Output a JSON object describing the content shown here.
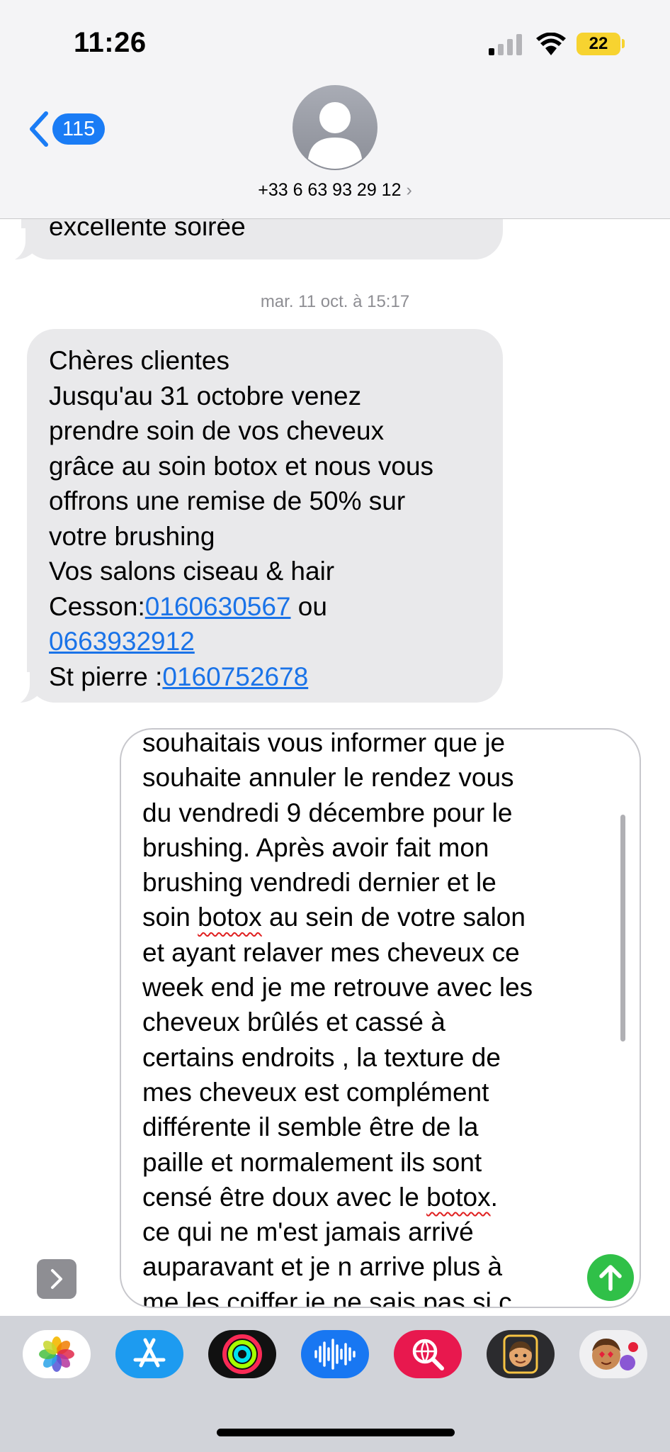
{
  "status_bar": {
    "time": "11:26",
    "battery": "22"
  },
  "header": {
    "back_count": "115",
    "contact": "+33 6 63 93 29 12",
    "chevron": "›"
  },
  "thread": {
    "previous_tail_line": "excellente soirée",
    "timestamp": "mar. 11 oct. à 15:17",
    "message": {
      "lines": [
        "Chères clientes",
        "Jusqu'au 31 octobre venez",
        "prendre soin de vos cheveux",
        "grâce au soin botox et nous vous",
        "offrons une remise de 50% sur",
        "votre brushing",
        "Vos salons ciseau & hair"
      ],
      "cesson_label": "Cesson:",
      "cesson_phone1": "0160630567",
      "or_text": " ou",
      "cesson_phone2": "0663932912",
      "stpierre_label": "St pierre :",
      "stpierre_phone": "0160752678"
    }
  },
  "compose": {
    "lines": [
      "souhaitais vous informer que je",
      "souhaite annuler le rendez vous",
      "du vendredi 9 décembre pour le",
      "brushing. Après avoir fait mon",
      "brushing vendredi dernier et le",
      "soin |botox| au sein de votre salon",
      "et ayant relaver mes cheveux ce",
      "week end je me retrouve avec les",
      "cheveux brûlés et cassé à",
      "certains endroits  , la texture de",
      "mes cheveux est complément",
      "différente il semble être de la",
      "paille et normalement ils sont",
      "censé être doux avec le |botox|.",
      "ce qui ne m'est jamais arrivé",
      "auparavant et je n arrive plus à",
      "me les coiffer  je ne sais pas si c"
    ]
  },
  "dock": {
    "apps": [
      "photos-icon",
      "app-store-icon",
      "fitness-rings-icon",
      "audio-message-icon",
      "web-search-icon",
      "memoji-icon",
      "memoji-stickers-icon"
    ]
  },
  "colors": {
    "accent": "#1a7cf5",
    "send": "#30c048",
    "bubble": "#e9e9eb",
    "battery": "#f7d330"
  }
}
